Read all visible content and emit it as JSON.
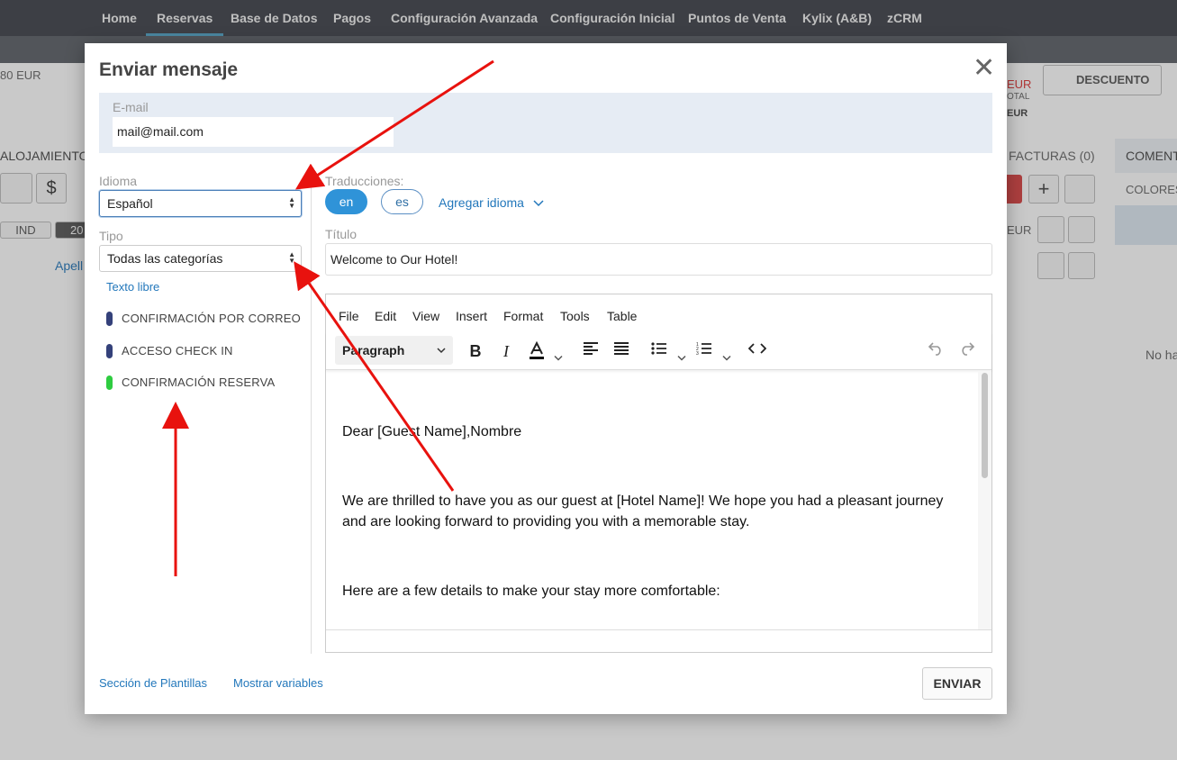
{
  "topnav": {
    "items": [
      "Home",
      "Reservas",
      "Base de Datos",
      "Pagos",
      "Configuración Avanzada",
      "Configuración Inicial",
      "Puntos de Venta",
      "Kylix (A&B)",
      "zCRM"
    ],
    "active": "Reservas"
  },
  "background": {
    "amount": "80 EUR",
    "alojamiento": "ALOJAMIENTO",
    "ind": "IND",
    "year": "20",
    "apell": "Apell",
    "eur1": "EUR",
    "otal": "OTAL",
    "eur2": "EUR",
    "descuento": "DESCUENTO",
    "facturas": "FACTURAS (0)",
    "coment": "COMENT",
    "colores": "COLORES",
    "eur3": "EUR",
    "noha": "No ha"
  },
  "modal": {
    "title": "Enviar mensaje",
    "email": {
      "label": "E-mail",
      "value": "mail@mail.com"
    },
    "idioma": {
      "label": "Idioma",
      "value": "Español"
    },
    "tipo": {
      "label": "Tipo",
      "value": "Todas las categorías"
    },
    "texto_libre": "Texto libre",
    "templates": [
      {
        "label": "CONFIRMACIÓN POR CORREO",
        "color": "#34417a"
      },
      {
        "label": "ACCESO CHECK IN",
        "color": "#34417a"
      },
      {
        "label": "CONFIRMACIÓN RESERVA",
        "color": "#2ecc40"
      }
    ],
    "traducciones": {
      "label": "Traducciones:",
      "langs": [
        "en",
        "es"
      ],
      "active": "en",
      "add": "Agregar idioma"
    },
    "titulo": {
      "label": "Título",
      "value": "Welcome to Our Hotel!"
    },
    "editor": {
      "menu": [
        "File",
        "Edit",
        "View",
        "Insert",
        "Format",
        "Tools",
        "Table"
      ],
      "block_format": "Paragraph",
      "paragraphs": [
        "Dear [Guest Name],Nombre",
        "We are thrilled to have you as our guest at [Hotel Name]! We hope you had a pleasant journey and are looking forward to providing you with a memorable stay.",
        "Here are a few details to make your stay more comfortable:"
      ]
    },
    "footer": {
      "templates_link": "Sección de Plantillas",
      "variables_link": "Mostrar variables",
      "send": "ENVIAR"
    }
  },
  "colors": {
    "accent": "#2f93d8",
    "arrow": "#e8120e",
    "nav": "#3d4148"
  }
}
